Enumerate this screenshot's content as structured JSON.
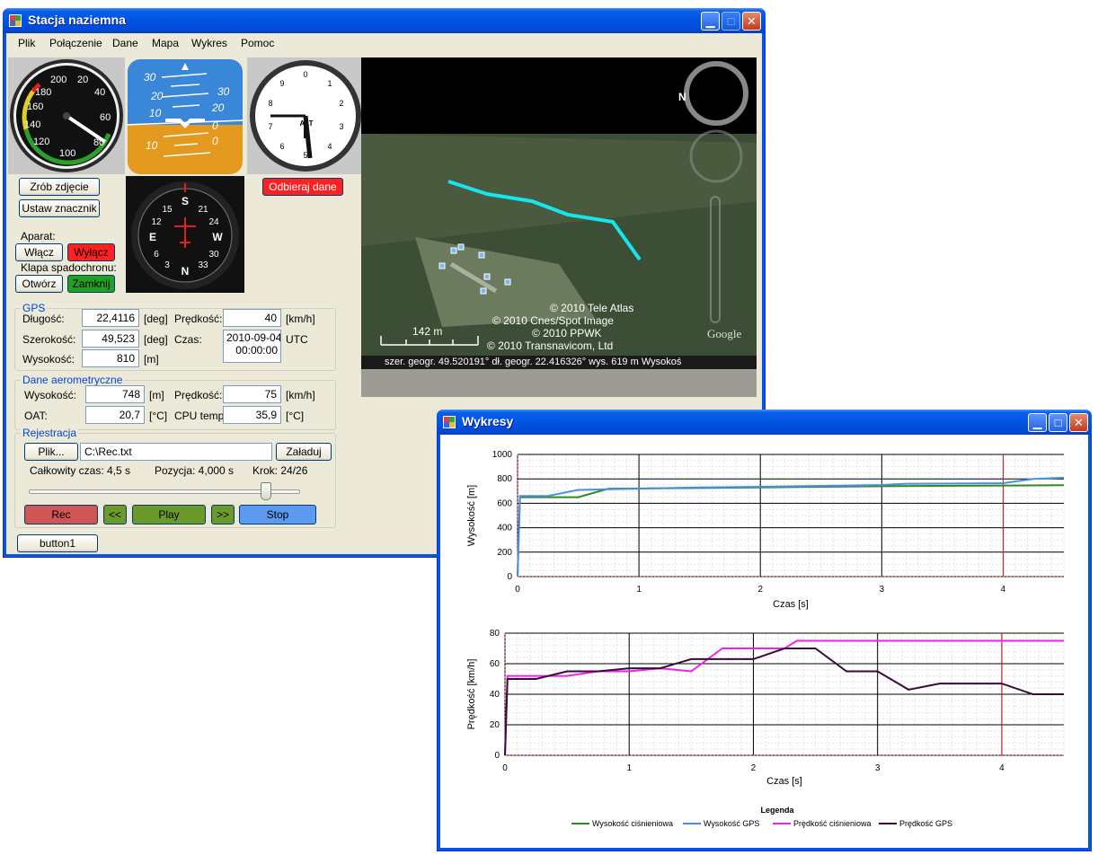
{
  "main_window": {
    "title": "Stacja naziemna",
    "menu": [
      "Plik",
      "Połączenie",
      "Dane",
      "Mapa",
      "Wykres",
      "Pomoc"
    ]
  },
  "buttons": {
    "photo": "Zrób zdjęcie",
    "marker": "Ustaw znacznik",
    "receive": "Odbieraj dane",
    "camera_on": "Włącz",
    "camera_off": "Wyłącz",
    "open": "Otwórz",
    "close": "Zamknij",
    "file": "Plik...",
    "load": "Załaduj",
    "rec": "Rec",
    "rewind": "<<",
    "play": "Play",
    "forward": ">>",
    "stop": "Stop",
    "button1": "button1"
  },
  "labels": {
    "camera": "Aparat:",
    "parachute": "Klapa spadochronu:"
  },
  "gps": {
    "title": "GPS",
    "lon_label": "Długość:",
    "lon_value": "22,4116",
    "lon_unit": "[deg]",
    "lat_label": "Szerokość:",
    "lat_value": "49,523",
    "lat_unit": "[deg]",
    "alt_label": "Wysokość:",
    "alt_value": "810",
    "alt_unit": "[m]",
    "speed_label": "Prędkość:",
    "speed_value": "40",
    "speed_unit": "[km/h]",
    "time_label": "Czas:",
    "time_date": "2010-09-04",
    "time_clock": "00:00:00",
    "time_zone": "UTC"
  },
  "aero": {
    "title": "Dane aerometryczne",
    "alt_label": "Wysokość:",
    "alt_value": "748",
    "alt_unit": "[m]",
    "oat_label": "OAT:",
    "oat_value": "20,7",
    "oat_unit": "[°C]",
    "speed_label": "Prędkość:",
    "speed_value": "75",
    "speed_unit": "[km/h]",
    "cpu_label": "CPU temp:",
    "cpu_value": "35,9",
    "cpu_unit": "[°C]"
  },
  "registration": {
    "title": "Rejestracja",
    "file_path": "C:\\Rec.txt",
    "total_time": "Całkowity czas: 4,5 s",
    "position": "Pozycja: 4,000 s",
    "step": "Krok: 24/26",
    "slider_fraction": 0.89
  },
  "map": {
    "copyright1": "© 2010 Tele Atlas",
    "copyright2": "© 2010 Cnes/Spot Image",
    "copyright3": "© 2010 PPWK",
    "copyright4": "© 2010 Transnavicom, Ltd",
    "scale": "142 m",
    "status": "szer. geogr.  49.520191°    dł. geogr.  22.416326°    wys. 619 m  Wysokoś",
    "brand": "Google",
    "compass_letter": "N"
  },
  "instruments": {
    "airspeed_ticks": [
      "200",
      "20",
      "40",
      "180",
      "160",
      "60",
      "140",
      "80",
      "120",
      "100"
    ],
    "attitude_ticks": [
      "30",
      "20",
      "10",
      "10",
      "30",
      "20",
      "0",
      "0"
    ],
    "altimeter_label": "ALT",
    "altimeter_ticks": [
      "0",
      "1",
      "2",
      "3",
      "4",
      "5",
      "6",
      "7",
      "8",
      "9"
    ],
    "heading_ticks": [
      "S",
      "E",
      "N",
      "W",
      "15",
      "21",
      "24",
      "30",
      "33",
      "6",
      "12",
      "3"
    ]
  },
  "chart_window": {
    "title": "Wykresy"
  },
  "legend": {
    "title": "Legenda"
  },
  "colors": {
    "baro_alt": "#2e8b22",
    "gps_alt": "#4a90e2",
    "baro_speed": "#ee22ee",
    "gps_speed": "#3a0a38",
    "cursor": "#dd2222"
  },
  "chart_data": [
    {
      "type": "line",
      "xlabel": "Czas [s]",
      "ylabel": "Wysokość [m]",
      "xlim": [
        0,
        4.5
      ],
      "ylim": [
        0,
        1000
      ],
      "xticks": [
        "0",
        "1",
        "2",
        "3",
        "4"
      ],
      "yticks": [
        "0",
        "200",
        "400",
        "600",
        "800",
        "1000"
      ],
      "cursor_x": 4,
      "series": [
        {
          "name": "Wysokość ciśnieniowa",
          "color_key": "baro_alt",
          "x": [
            0,
            0.02,
            0.5,
            0.75,
            1.5,
            2.0,
            3.0,
            4.0,
            4.5
          ],
          "y": [
            0,
            650,
            650,
            720,
            725,
            730,
            740,
            745,
            748
          ]
        },
        {
          "name": "Wysokość GPS",
          "color_key": "gps_alt",
          "x": [
            0,
            0.02,
            0.25,
            0.5,
            0.75,
            1.0,
            1.5,
            2.0,
            3.0,
            3.2,
            4.0,
            4.25,
            4.5
          ],
          "y": [
            0,
            660,
            660,
            710,
            715,
            720,
            730,
            735,
            750,
            760,
            765,
            800,
            810
          ]
        }
      ]
    },
    {
      "type": "line",
      "xlabel": "Czas [s]",
      "ylabel": "Prędkość [km/h]",
      "xlim": [
        0,
        4.5
      ],
      "ylim": [
        0,
        80
      ],
      "xticks": [
        "0",
        "1",
        "2",
        "3",
        "4"
      ],
      "yticks": [
        "0",
        "20",
        "40",
        "60",
        "80"
      ],
      "cursor_x": 4,
      "series": [
        {
          "name": "Prędkość ciśnieniowa",
          "color_key": "baro_speed",
          "x": [
            0,
            0.02,
            0.5,
            0.75,
            1.0,
            1.25,
            1.5,
            1.75,
            2.0,
            2.25,
            2.35,
            3.0,
            4.0,
            4.5
          ],
          "y": [
            0,
            52,
            52,
            55,
            55,
            57,
            55,
            70,
            70,
            70,
            75,
            75,
            75,
            75
          ]
        },
        {
          "name": "Prędkość GPS",
          "color_key": "gps_speed",
          "x": [
            0,
            0.02,
            0.25,
            0.5,
            0.75,
            1.0,
            1.25,
            1.5,
            1.75,
            2.0,
            2.25,
            2.5,
            2.75,
            3.0,
            3.25,
            3.5,
            4.0,
            4.25,
            4.5
          ],
          "y": [
            0,
            50,
            50,
            55,
            55,
            57,
            57,
            63,
            63,
            63,
            70,
            70,
            55,
            55,
            43,
            47,
            47,
            40,
            40
          ]
        }
      ]
    }
  ]
}
